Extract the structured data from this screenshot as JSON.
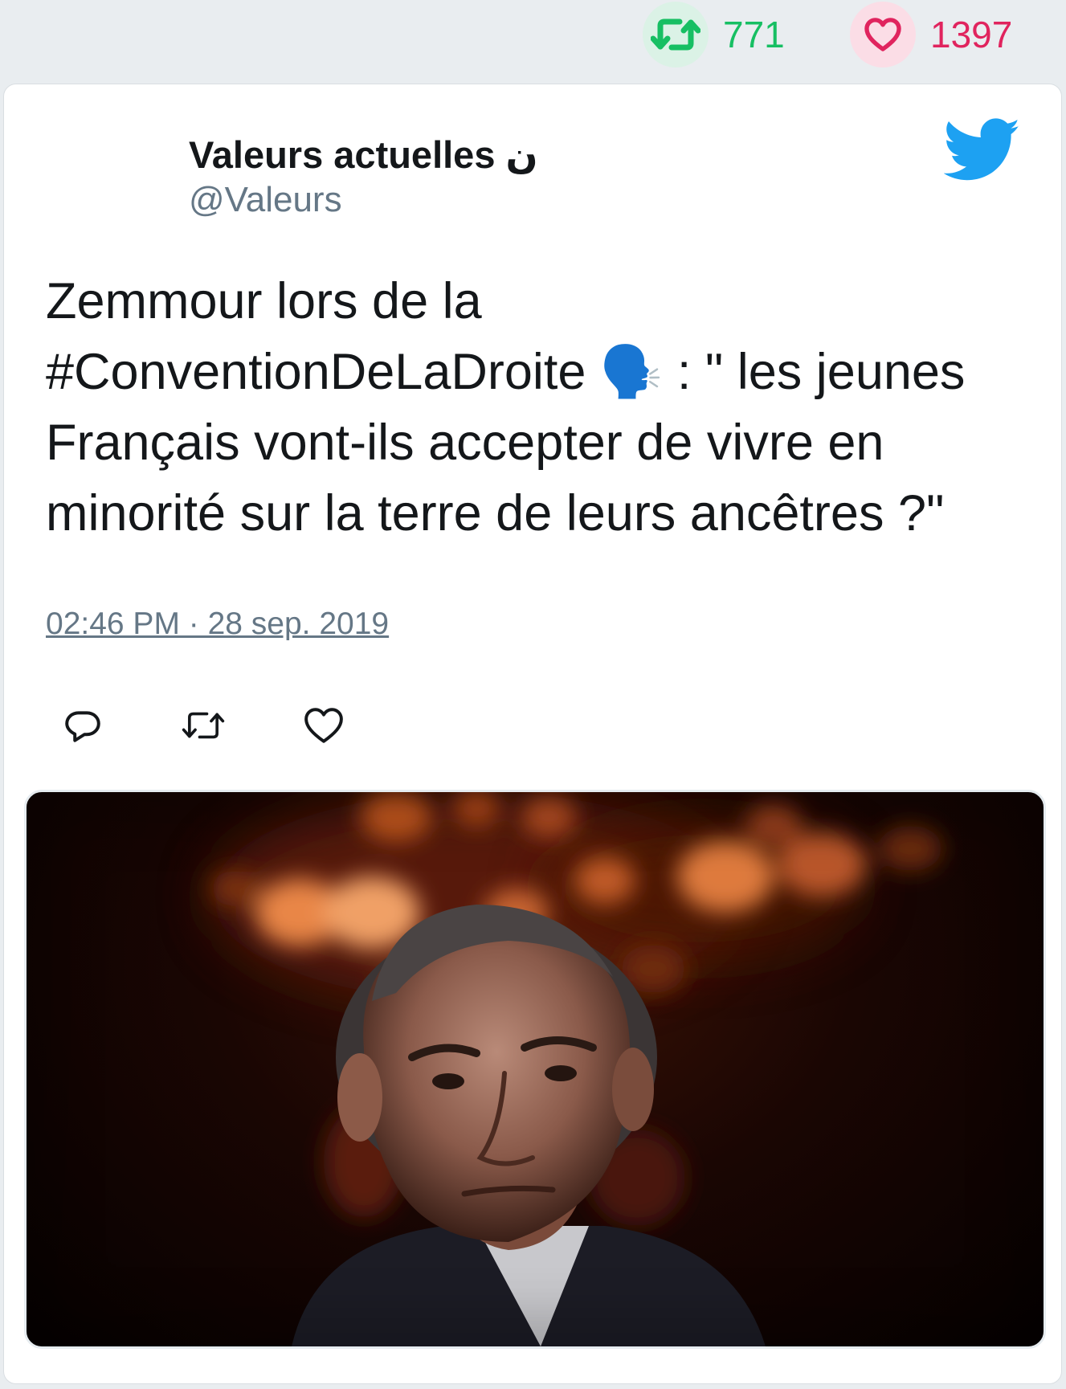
{
  "stats": {
    "retweets": "771",
    "likes": "1397"
  },
  "tweet": {
    "author_name": "Valeurs actuelles ن",
    "author_handle": "@Valeurs",
    "text": "Zemmour lors de la #ConventionDeLaDroite 🗣️ : \" les jeunes Français vont-ils accepter de vivre en minorité sur la terre de leurs ancêtres ?\"",
    "timestamp": "02:46 PM · 28 sep. 2019"
  },
  "icons": {
    "retweet_stat": "retweet-icon",
    "like_stat": "heart-icon",
    "brand": "twitter-bird-icon",
    "actions": [
      "reply-icon",
      "retweet-icon",
      "heart-icon"
    ]
  },
  "colors": {
    "background": "#e9edf0",
    "retweet_green": "#17bf63",
    "like_red": "#e0245e",
    "twitter_blue": "#1da1f2",
    "secondary_text": "#657786",
    "primary_text": "#14171a"
  }
}
